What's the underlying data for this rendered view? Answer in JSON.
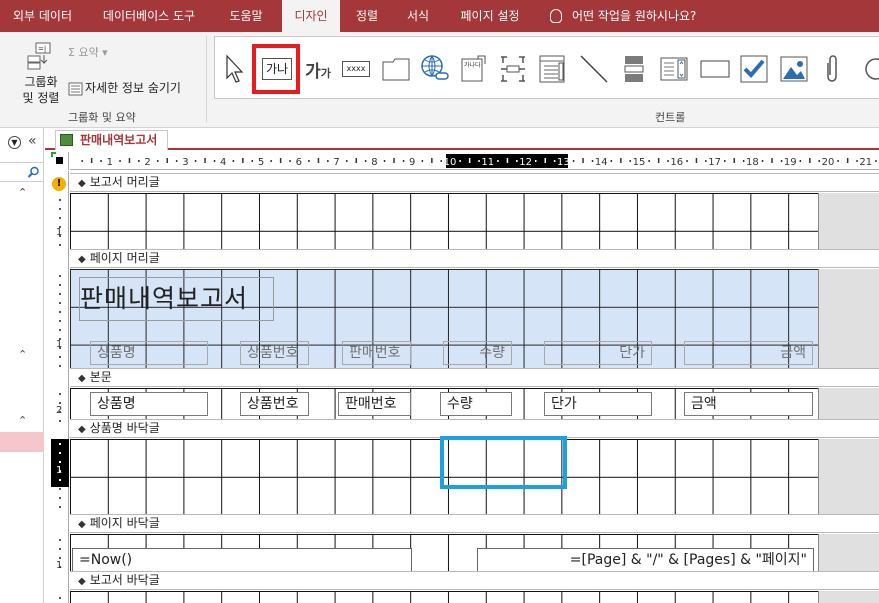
{
  "ribbon_tabs": [
    "외부 데이터",
    "데이터베이스 도구",
    "도움말",
    "디자인",
    "정렬",
    "서식",
    "페이지 설정"
  ],
  "active_tab": "디자인",
  "tell_me": "어떤 작업을 원하시나요?",
  "group_sort": {
    "button_label_1": "그룹화",
    "button_label_2": "및 정렬",
    "summary": "Σ 요약 ▾",
    "hide_details": "자세한 정보 숨기기",
    "group_label": "그룹화 및 요약"
  },
  "controls": {
    "group_label": "컨트롤",
    "label_tool_text": "가나",
    "textbox_tool_text": "xxxx",
    "combo_tool_text": "가나다",
    "items": [
      "select-arrow",
      "label",
      "text-box",
      "button",
      "tab-control",
      "hyperlink",
      "web-browser",
      "navigation-control",
      "option-group",
      "insert-page-break",
      "combo-box",
      "line",
      "toggle-button",
      "list-box",
      "rectangle",
      "check-box",
      "image",
      "attachment"
    ]
  },
  "nav": {
    "search_icon": "search-icon",
    "collapse": "«"
  },
  "document": {
    "tab_title": "판매내역보고서"
  },
  "ruler": {
    "labels": [
      "1",
      "2",
      "3",
      "4",
      "5",
      "6",
      "7",
      "8",
      "9",
      "10",
      "11",
      "12",
      "13",
      "14",
      "15",
      "16",
      "17",
      "18",
      "19",
      "20",
      "21"
    ]
  },
  "vruler_labels": [
    "1",
    "1",
    "2",
    "1",
    "1"
  ],
  "sections": {
    "report_header": "보고서 머리글",
    "page_header": "페이지 머리글",
    "detail": "본문",
    "group_footer": "상품명 바닥글",
    "page_footer": "페이지 바닥글",
    "report_footer": "보고서 바닥글"
  },
  "page_header": {
    "title": "판매내역보고서",
    "labels": [
      "상품명",
      "상품번호",
      "판매번호",
      "수량",
      "단가",
      "금액"
    ]
  },
  "detail": {
    "fields": [
      "상품명",
      "상품번호",
      "판매번호",
      "수량",
      "단가",
      "금액"
    ]
  },
  "page_footer": {
    "now": "=Now()",
    "pages": "=[Page] & \"/\" & [Pages] & \"페이지\""
  }
}
